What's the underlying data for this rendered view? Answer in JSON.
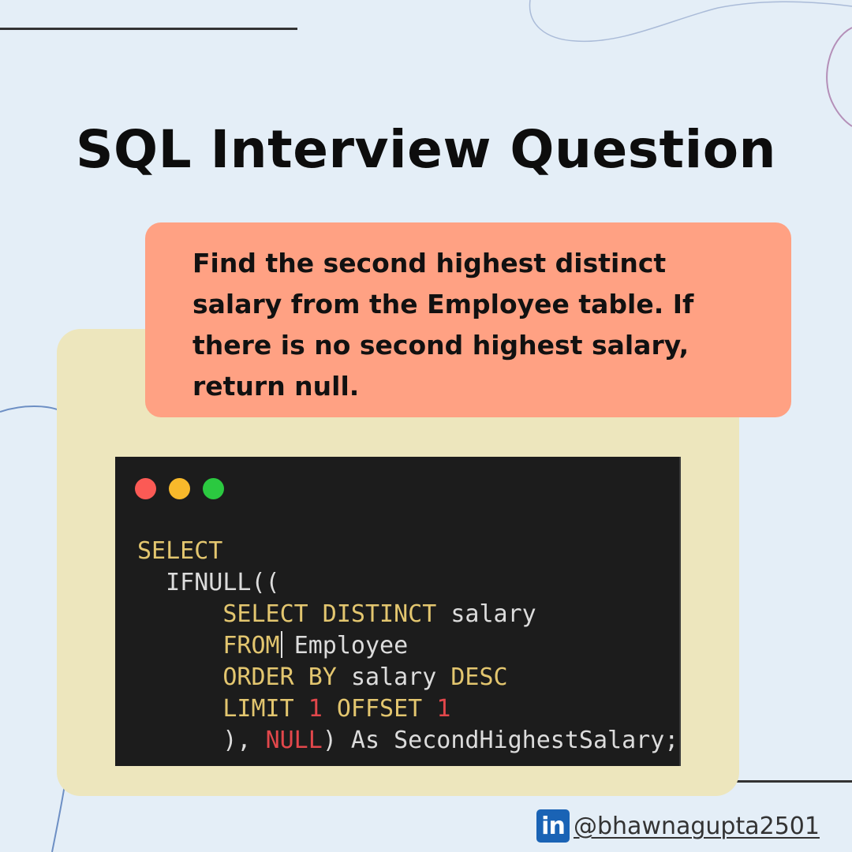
{
  "title": "SQL Interview Question",
  "question": "Find the second highest distinct salary from the Employee table. If there is no second highest salary, return null.",
  "code_window": {
    "buttons": [
      "close",
      "minimize",
      "maximize"
    ],
    "lines": [
      "SELECT",
      "  IFNULL((",
      "      SELECT DISTINCT salary",
      "      FROM Employee",
      "      ORDER BY salary DESC",
      "      LIMIT 1 OFFSET 1",
      "      ), NULL) As SecondHighestSalary;"
    ],
    "tokens": {
      "select": "SELECT",
      "ifnull": "IFNULL((",
      "select_distinct": "SELECT DISTINCT",
      "salary": "salary",
      "from": "FROM",
      "employee": "Employee",
      "order_by": "ORDER BY",
      "desc": "DESC",
      "limit": "LIMIT",
      "one_a": "1",
      "offset": "OFFSET",
      "one_b": "1",
      "close_paren": "),",
      "null": "NULL",
      "close_as": ") As",
      "alias": "SecondHighestSalary;"
    }
  },
  "footer": {
    "icon": "linkedin-icon",
    "icon_text": "in",
    "handle": "@bhawnagupta2501"
  },
  "colors": {
    "background": "#e4eef7",
    "question_box": "#ffa183",
    "card": "#ede6bd",
    "code_bg": "#1c1c1c",
    "keyword": "#e3c66f",
    "number": "#e2474b",
    "linkedin": "#1a63b5"
  }
}
